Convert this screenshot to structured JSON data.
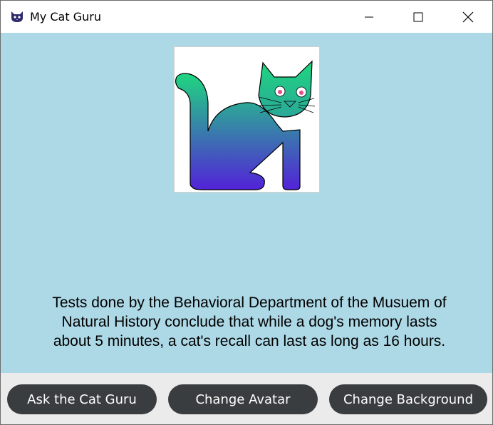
{
  "window": {
    "title": "My Cat Guru",
    "app_icon": "cat-head-icon",
    "controls": [
      "minimize-icon",
      "maximize-icon",
      "close-icon"
    ]
  },
  "avatar": {
    "icon": "cat-avatar-icon",
    "gradient_top": "#1fd680",
    "gradient_bottom": "#5222d8",
    "background": "#add8e6"
  },
  "fact": {
    "text": "Tests done by the Behavioral Department of the Musuem of Natural History conclude that while a dog's memory lasts about 5 minutes, a cat's recall can last as long as 16 hours."
  },
  "buttons": {
    "ask_label": "Ask the Cat Guru",
    "avatar_label": "Change Avatar",
    "background_label": "Change Background",
    "color": "#3a3d40"
  }
}
